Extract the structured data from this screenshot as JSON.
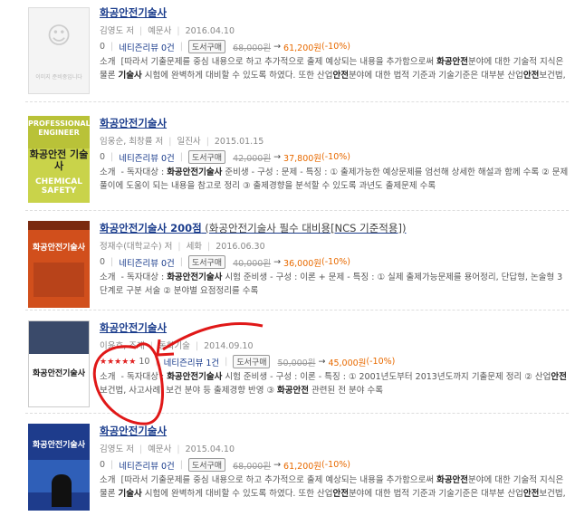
{
  "items": [
    {
      "title": "화공안전기술사",
      "sub": "",
      "author": "김영도 저",
      "publisher": "예문사",
      "date": "2016.04.10",
      "rating_stars": "",
      "rating_count": "0",
      "review": "네티즌리뷰 0건",
      "buy": "도서구매",
      "price_old": "68,000원",
      "price_new": "61,200원",
      "discount": "(-10%)",
      "desc_label": "소개",
      "desc": "[따라서 기출문제를 중심 내용으로 하고 추가적으로 출제 예상되는 내용을 추가함으로써 화공안전분야에 대한 기술적 지식은 물론 기술사 시험에 완벽하게 대비할 수 있도록 하였다. 또한 산업안전분야에 대한 법적 기준과 기술기준은 대부분 산업안전보건법, 노동부고시 및..."
    },
    {
      "title": "화공안전기술사",
      "sub": "",
      "author": "임웅순, 최창률 저",
      "publisher": "일진사",
      "date": "2015.01.15",
      "rating_stars": "",
      "rating_count": "0",
      "review": "네티즌리뷰 0건",
      "buy": "도서구매",
      "price_old": "42,000원",
      "price_new": "37,800원",
      "discount": "(-10%)",
      "desc_label": "소개",
      "desc": "- 독자대상 : 화공안전기술사 준비생 - 구성 : 문제 - 특징 : ① 출제가능한 예상문제를 엄선해 상세한 해설과 함께 수록 ② 문제풀이에 도움이 되는 내용을 참고로 정리 ③ 출제경향을 분석할 수 있도록 과년도 출제문제 수록"
    },
    {
      "title": "화공안전기술사 200점",
      "sub": " (화공안전기술사 필수 대비용[NCS 기준적용])",
      "author": "정재수(대학교수) 저",
      "publisher": "세화",
      "date": "2016.06.30",
      "rating_stars": "",
      "rating_count": "0",
      "review": "네티즌리뷰 0건",
      "buy": "도서구매",
      "price_old": "40,000원",
      "price_new": "36,000원",
      "discount": "(-10%)",
      "desc_label": "소개",
      "desc": "- 독자대상 : 화공안전기술사 시험 준비생 - 구성 : 이론 + 문제 - 특징 : ① 실제 출제가능문제를 용어정리, 단답형, 논술형 3단계로 구분 서술 ② 분야별 요점정리를 수록"
    },
    {
      "title": "화공안전기술사",
      "sub": "",
      "author": "이윤호, 조재",
      "publisher": "동화기술",
      "date": "2014.09.10",
      "rating_stars": "★★★★★",
      "rating_count": "10",
      "review": "네티즌리뷰 1건",
      "buy": "도서구매",
      "price_old": "50,000원",
      "price_new": "45,000원",
      "discount": "(-10%)",
      "desc_label": "소개",
      "desc": "- 독자대상 : 화공안전기술사 시험 준비생 - 구성 : 이론 - 특징 : ① 2001년도부터 2013년도까지 기출문제 정리 ② 산업안전보건법, 사고사례, 보건 분야 등 출제경향 반영 ③ 화공안전 관련된 전 분야 수록"
    },
    {
      "title": "화공안전기술사",
      "sub": "",
      "author": "김영도 저",
      "publisher": "예문사",
      "date": "2015.04.10",
      "rating_stars": "",
      "rating_count": "0",
      "review": "네티즌리뷰 0건",
      "buy": "도서구매",
      "price_old": "68,000원",
      "price_new": "61,200원",
      "discount": "(-10%)",
      "desc_label": "소개",
      "desc": "[따라서 기출문제를 중심 내용으로 하고 추가적으로 출제 예상되는 내용을 추가함으로써 화공안전분야에 대한 기술적 지식은 물론 기술사 시험에 완벽하게 대비할 수 있도록 하였다. 또한 산업안전분야에 대한 법적 기준과 기술기준은 대부분 산업안전보건법, 노동부고시 및..."
    }
  ],
  "covers": {
    "c1_caption": "이미지 준비중입니다",
    "c2_band": "PROFESSIONAL ENGINEER",
    "c2_name": "화공안전 기술사",
    "c2_bottom": "CHEMICAL SAFETY",
    "c3_name": "화공안전기술사",
    "c4_name": "화공안전기술사",
    "c5_name": "화공안전기술사"
  },
  "colors": {
    "title": "#1a3c8c",
    "price": "#e86a00",
    "annotation": "#e01818"
  }
}
